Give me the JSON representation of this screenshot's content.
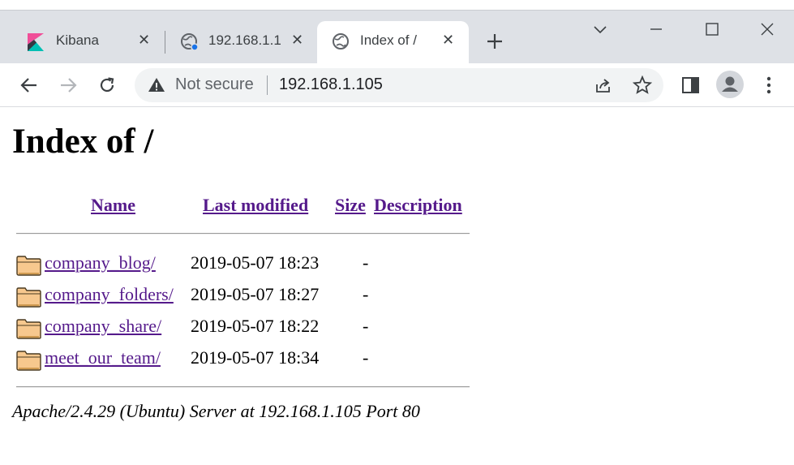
{
  "browser": {
    "tabs": [
      {
        "label": "Kibana",
        "icon": "kibana-logo-icon"
      },
      {
        "label": "192.168.1.1",
        "icon": "globe-icon"
      },
      {
        "label": "Index of /",
        "icon": "globe-icon"
      }
    ],
    "security_text": "Not secure",
    "url": "192.168.1.105"
  },
  "page": {
    "title": "Index of /",
    "columns": [
      "Name",
      "Last modified",
      "Size",
      "Description"
    ],
    "rows": [
      {
        "name": "company_blog/",
        "modified": "2019-05-07 18:23",
        "size": "-"
      },
      {
        "name": "company_folders/",
        "modified": "2019-05-07 18:27",
        "size": "-"
      },
      {
        "name": "company_share/",
        "modified": "2019-05-07 18:22",
        "size": "-"
      },
      {
        "name": "meet_our_team/",
        "modified": "2019-05-07 18:34",
        "size": "-"
      }
    ],
    "footer": "Apache/2.4.29 (Ubuntu) Server at 192.168.1.105 Port 80"
  },
  "colors": {
    "link_visited": "#551a8b",
    "chrome_bg": "#dee1e6",
    "folder_fill": "#f7c88e"
  }
}
